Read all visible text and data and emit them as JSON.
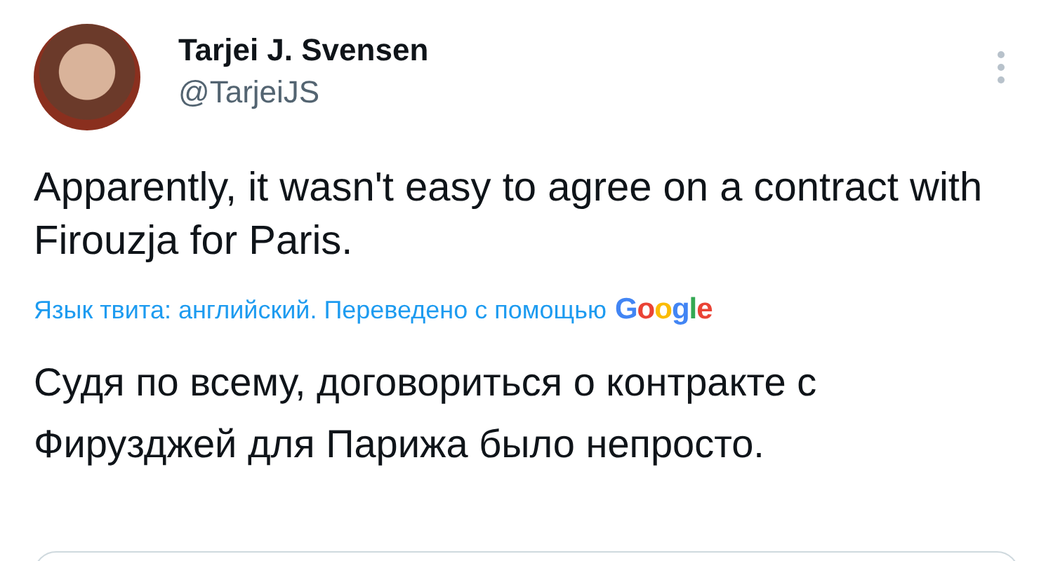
{
  "author": {
    "name": "Tarjei J. Svensen",
    "handle": "@TarjeiJS"
  },
  "tweet_text": "Apparently, it wasn't easy to agree on a contract with Firouzja for Paris.",
  "translation_note": {
    "text": "Язык твита: английский. Переведено с помощью",
    "provider": "Google"
  },
  "translated_text": "Судя по всему, договориться о контракте с Фирузджей для Парижа было непросто."
}
